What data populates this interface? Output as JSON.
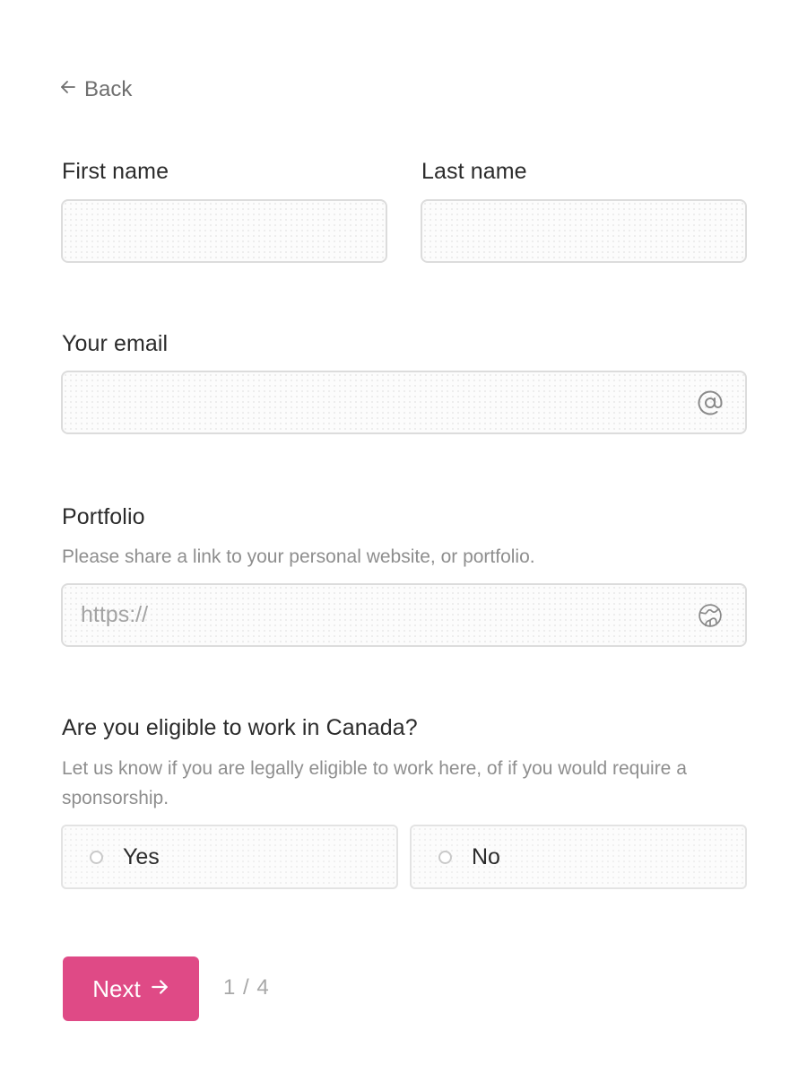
{
  "nav": {
    "back_label": "Back",
    "back_icon": "arrow-left-icon"
  },
  "form": {
    "first_name": {
      "label": "First name",
      "value": "",
      "placeholder": ""
    },
    "last_name": {
      "label": "Last name",
      "value": "",
      "placeholder": ""
    },
    "email": {
      "label": "Your email",
      "value": "",
      "placeholder": "",
      "icon": "at-sign-icon"
    },
    "portfolio": {
      "label": "Portfolio",
      "hint": "Please share a link to your personal website, or portfolio.",
      "value": "",
      "placeholder": "https://",
      "icon": "globe-icon"
    },
    "eligibility": {
      "label": "Are you eligible to work in Canada?",
      "hint": "Let us know if you are legally eligible to work here, of if you would require a sponsorship.",
      "options": [
        {
          "label": "Yes",
          "selected": false
        },
        {
          "label": "No",
          "selected": false
        }
      ]
    }
  },
  "footer": {
    "next_label": "Next",
    "next_icon": "arrow-right-icon",
    "step_counter": "1 / 4"
  },
  "colors": {
    "accent": "#df4a86",
    "border": "#dcdcdc",
    "muted_text": "#8e8e8e"
  }
}
